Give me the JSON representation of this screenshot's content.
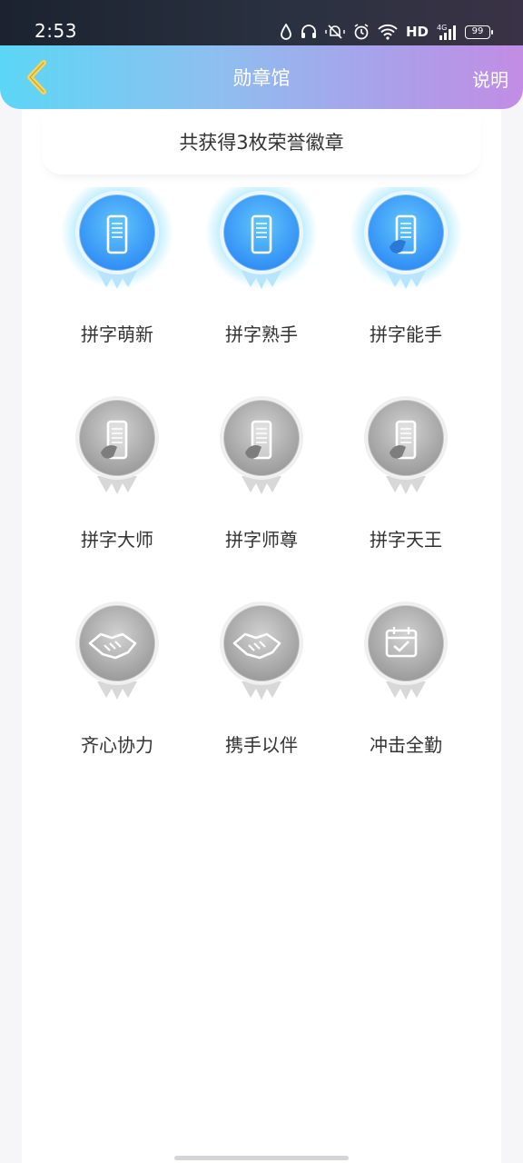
{
  "status_bar": {
    "time": "2:53",
    "network": "HD",
    "signal_label": "4G",
    "battery": "99"
  },
  "header": {
    "title": "勋章馆",
    "help_label": "说明"
  },
  "summary": {
    "text": "共获得3枚荣誉徽章"
  },
  "badges": [
    {
      "label": "拼字萌新",
      "earned": true,
      "icon": "phone-icon"
    },
    {
      "label": "拼字熟手",
      "earned": true,
      "icon": "phone-icon"
    },
    {
      "label": "拼字能手",
      "earned": true,
      "icon": "phone-hand-icon"
    },
    {
      "label": "拼字大师",
      "earned": false,
      "icon": "phone-hand-icon"
    },
    {
      "label": "拼字师尊",
      "earned": false,
      "icon": "phone-hand-icon"
    },
    {
      "label": "拼字天王",
      "earned": false,
      "icon": "phone-hand-icon"
    },
    {
      "label": "齐心协力",
      "earned": false,
      "icon": "handshake-icon"
    },
    {
      "label": "携手以伴",
      "earned": false,
      "icon": "handshake-icon"
    },
    {
      "label": "冲击全勤",
      "earned": false,
      "icon": "calendar-check-icon"
    }
  ],
  "colors": {
    "header_start": "#5cd6f6",
    "header_end": "#c28de4",
    "earned_badge": "#2f8cf5",
    "locked_badge": "#9a9a9a"
  }
}
